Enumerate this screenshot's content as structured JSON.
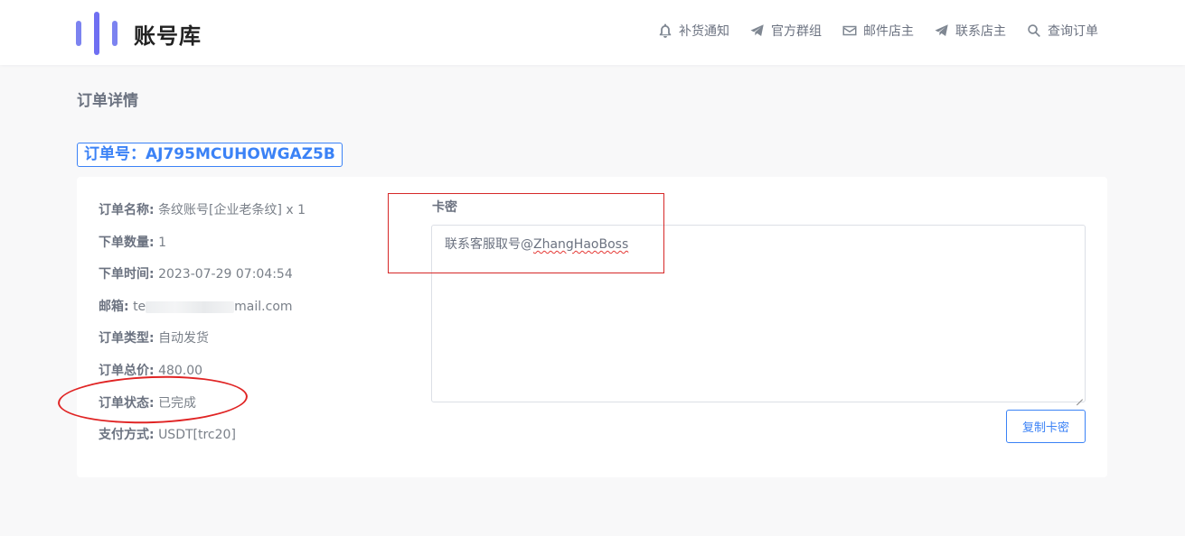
{
  "header": {
    "logo_text": "账号库",
    "nav": [
      {
        "label": "补货通知",
        "icon": "bell-icon"
      },
      {
        "label": "官方群组",
        "icon": "paper-plane-icon"
      },
      {
        "label": "邮件店主",
        "icon": "envelope-icon"
      },
      {
        "label": "联系店主",
        "icon": "paper-plane-icon"
      },
      {
        "label": "查询订单",
        "icon": "search-icon"
      }
    ]
  },
  "page": {
    "title": "订单详情",
    "order_no": "订单号：AJ795MCUHOWGAZ5B"
  },
  "order": {
    "name_label": "订单名称:",
    "name_value": "条纹账号[企业老条纹] x 1",
    "qty_label": "下单数量:",
    "qty_value": "1",
    "time_label": "下单时间:",
    "time_value": "2023-07-29 07:04:54",
    "email_label": "邮箱:",
    "email_prefix": "te",
    "email_suffix": "mail.com",
    "type_label": "订单类型:",
    "type_value": "自动发货",
    "total_label": "订单总价:",
    "total_value": "480.00",
    "status_label": "订单状态:",
    "status_value": "已完成",
    "pay_label": "支付方式:",
    "pay_value": "USDT[trc20]"
  },
  "card_secret": {
    "label": "卡密",
    "content_prefix": "联系客服取号@",
    "content_handle": "ZhangHaoBoss",
    "copy_button": "复制卡密"
  },
  "colors": {
    "accent": "#3b82f6",
    "logo": "#6f6ff2",
    "annotation": "#e02424"
  }
}
